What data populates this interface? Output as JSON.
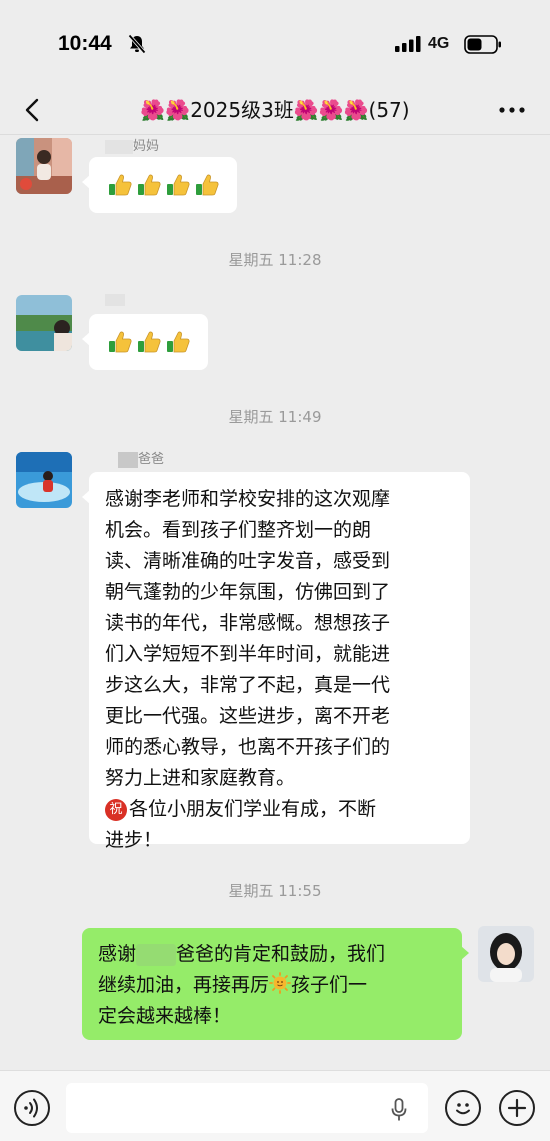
{
  "status_bar": {
    "time": "10:44",
    "network": "4G"
  },
  "header": {
    "title": "🌺🌺2025级3班🌺🌺🌺(57)"
  },
  "messages": [
    {
      "sender": "妈妈",
      "content": "👍👍👍👍"
    },
    {
      "timestamp": "星期五 11:28"
    },
    {
      "sender": "",
      "content": "👍👍👍"
    },
    {
      "timestamp": "星期五 11:49"
    },
    {
      "sender": "爸爸",
      "lines": [
        "感谢李老师和学校安排的这次观摩",
        "机会。看到孩子们整齐划一的朗",
        "读、清晰准确的吐字发音，感受到",
        "朝气蓬勃的少年氛围，仿佛回到了",
        "读书的年代，非常感慨。想想孩子",
        "们入学短短不到半年时间，就能进",
        "步这么大，非常了不起，真是一代",
        "更比一代强。这些进步，离不开老",
        "师的悉心教导，也离不开孩子们的",
        "努力上进和家庭教育。"
      ],
      "badge": "祝",
      "closing_1": "各位小朋友们学业有成，不断",
      "closing_2": "进步！"
    },
    {
      "timestamp": "星期五 11:55"
    },
    {
      "own": true,
      "line1_a": "感谢",
      "line1_b": "爸爸的肯定和鼓励，我们",
      "line2_a": "继续加油，再接再厉",
      "line2_b": "孩子们一",
      "line3": "定会越来越棒！"
    }
  ],
  "icons": {
    "back": "chevron-left-icon",
    "more": "more-dots-icon",
    "voice": "voice-icon",
    "mic": "mic-icon",
    "emoji": "emoji-icon",
    "plus": "plus-icon"
  },
  "colors": {
    "background": "#ededed",
    "bubble_incoming": "#ffffff",
    "bubble_outgoing": "#95ec69",
    "timestamp": "#9a9a9a"
  }
}
